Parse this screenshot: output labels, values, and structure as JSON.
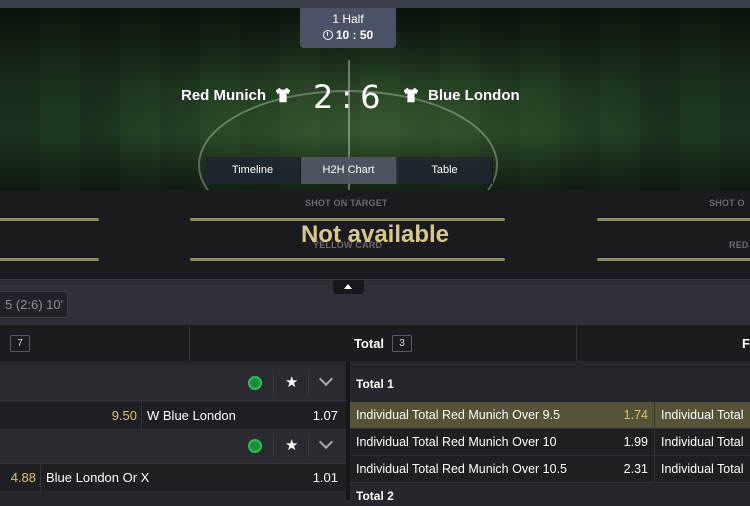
{
  "match": {
    "period": "1 Half",
    "clock": "10 : 50",
    "home_team": "Red Munich",
    "away_team": "Blue London",
    "home_score": "2",
    "away_score": "6",
    "separator": ":",
    "tabs": [
      "Timeline",
      "H2H Chart",
      "Table"
    ],
    "active_tab": "H2H Chart"
  },
  "stats": {
    "captions": [
      "SHOT ON TARGET",
      "SHOT O",
      "YELLOW CARD",
      "RED"
    ],
    "overlay": "Not available"
  },
  "filter": {
    "chip_text": "5 (2:6) 10'"
  },
  "market_tabs": [
    {
      "label": "",
      "count": "7"
    },
    {
      "label": "Total",
      "count": "3"
    },
    {
      "label": "F",
      "count": ""
    }
  ],
  "left_markets": [
    {
      "icons": [
        "ball-icon",
        "star-icon",
        "chevron-down-icon"
      ],
      "row": {
        "odd_a": "9.50",
        "name": "W Blue London",
        "odd_b": "1.07"
      }
    },
    {
      "icons": [
        "ball-icon",
        "star-icon",
        "chevron-down-icon"
      ],
      "row": {
        "odd_a": "4.88",
        "name": "Blue London Or X",
        "odd_b": "1.01"
      }
    }
  ],
  "right_markets": {
    "title": "Total 1",
    "rows": [
      {
        "name": "Individual Total Red Munich Over 9.5",
        "odd": "1.74",
        "next": "Individual Total",
        "highlight": true
      },
      {
        "name": "Individual Total Red Munich Over 10",
        "odd": "1.99",
        "next": "Individual Total",
        "highlight": false
      },
      {
        "name": "Individual Total Red Munich Over 10.5",
        "odd": "2.31",
        "next": "Individual Total",
        "highlight": false
      }
    ],
    "next_title": "Total 2"
  },
  "colors": {
    "accent_yellow": "#d5c86e",
    "highlight_row": "#565438",
    "panel": "#1e1e23"
  }
}
